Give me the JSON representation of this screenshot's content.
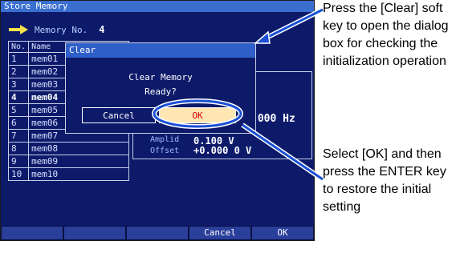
{
  "screen": {
    "title": "Store Memory",
    "memory_no_label": "Memory No.",
    "memory_no_value": "4",
    "table": {
      "headers": [
        "No.",
        "Name"
      ],
      "rows": [
        {
          "no": "1",
          "name": "mem01"
        },
        {
          "no": "2",
          "name": "mem02"
        },
        {
          "no": "3",
          "name": "mem03"
        },
        {
          "no": "4",
          "name": "mem04"
        },
        {
          "no": "5",
          "name": "mem05"
        },
        {
          "no": "6",
          "name": "mem06"
        },
        {
          "no": "7",
          "name": "mem07"
        },
        {
          "no": "8",
          "name": "mem08"
        },
        {
          "no": "9",
          "name": "mem09"
        },
        {
          "no": "10",
          "name": "mem10"
        }
      ]
    },
    "info": {
      "freq_value": ".000 Hz",
      "ampl_label": "Amplid",
      "ampl_value": "0.100 V",
      "offset_label": "Offset",
      "offset_value": "+0.000 0 V"
    },
    "softkeys": [
      "",
      "",
      "",
      "Cancel",
      "OK"
    ]
  },
  "dialog": {
    "title": "Clear",
    "message_line1": "Clear Memory",
    "message_line2": "Ready?",
    "cancel_label": "Cancel",
    "ok_label": "OK"
  },
  "annotations": {
    "note1": "Press the [Clear] soft key to open the dialog box for checking the initialization operation",
    "note2": "Select [OK] and then press the ENTER key to restore the initial setting"
  },
  "colors": {
    "screen_bg": "#0d1a6a",
    "title_bar": "#3a6fd0",
    "ok_highlight": "#ffe6b3",
    "ok_text": "#d20000",
    "callout_blue": "#1a4fd6"
  }
}
